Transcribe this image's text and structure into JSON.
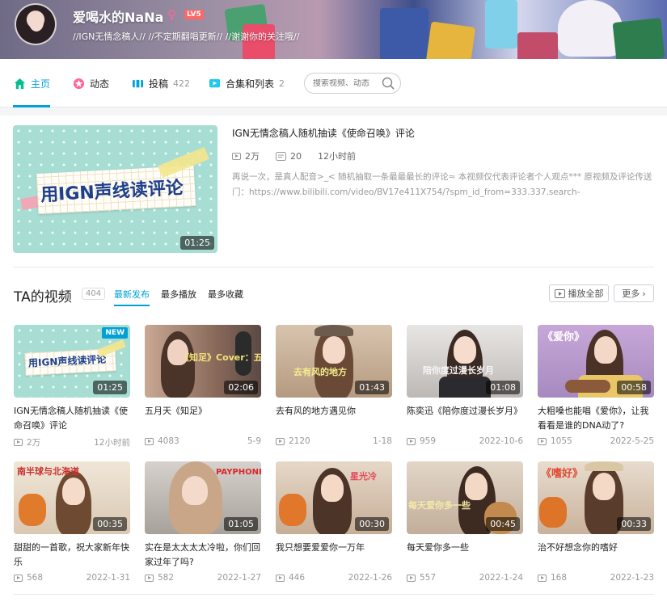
{
  "user": {
    "name": "爱喝水的NaNa",
    "gender_symbol": "♀",
    "level": "LV5",
    "sign": "//IGN无情念稿人// //不定期翻唱更新// //谢谢你的关注哦//"
  },
  "nav": {
    "items": [
      {
        "label": "主页",
        "count": ""
      },
      {
        "label": "动态",
        "count": ""
      },
      {
        "label": "投稿",
        "count": "422"
      },
      {
        "label": "合集和列表",
        "count": "2"
      }
    ],
    "search_placeholder": "搜索视频、动态"
  },
  "featured": {
    "title": "IGN无情念稿人随机抽读《使命召唤》评论",
    "plays": "2万",
    "danmaku": "20",
    "time": "12小时前",
    "description": "再说一次，是真人配音>_< 随机抽取一条最最最长的评论≈ 本视频仅代表评论者个人观点*** 原视频及评论传送门：https://www.bilibili.com/video/BV17e411X754/?spm_id_from=333.337.search-",
    "duration": "01:25",
    "thumb_text": "用IGN声线读评论"
  },
  "videos_section": {
    "title": "TA的视频",
    "count": "404",
    "tabs": [
      "最新发布",
      "最多播放",
      "最多收藏"
    ],
    "play_all": "播放全部",
    "more": "更多"
  },
  "videos": [
    {
      "title": "IGN无情念稿人随机抽读《使命召唤》评论",
      "plays": "2万",
      "date": "12小时前",
      "duration": "01:25",
      "tag": "NEW",
      "caption": "用IGN声线读评论"
    },
    {
      "title": "五月天《知足》",
      "plays": "4083",
      "date": "5-9",
      "duration": "02:06",
      "caption": "《知足》Cover：五月天"
    },
    {
      "title": "去有风的地方遇见你",
      "plays": "2120",
      "date": "1-18",
      "duration": "01:43",
      "caption": "去有风的地方"
    },
    {
      "title": "陈奕迅《陪你度过漫长岁月》",
      "plays": "959",
      "date": "2022-10-6",
      "duration": "01:08",
      "caption": "陪你度过漫长岁月"
    },
    {
      "title": "大粗嗓也能唱《爱你》，让我看看是谁的DNA动了?",
      "plays": "1055",
      "date": "2022-5-25",
      "duration": "00:58",
      "caption": "《爱你》"
    },
    {
      "title": "甜甜的一首歌，祝大家新年快乐",
      "plays": "568",
      "date": "2022-1-31",
      "duration": "00:35",
      "caption": "南半球与北海道"
    },
    {
      "title": "实在是太太太太冷啦，你们回家过年了吗?",
      "plays": "582",
      "date": "2022-1-27",
      "duration": "01:05",
      "caption": "PAYPHONE"
    },
    {
      "title": "我只想要爱爱你一万年",
      "plays": "446",
      "date": "2022-1-26",
      "duration": "00:30",
      "caption": "星光冷"
    },
    {
      "title": "每天爱你多一些",
      "plays": "557",
      "date": "2022-1-24",
      "duration": "00:45",
      "caption": "每天爱你多一些"
    },
    {
      "title": "治不好想念你的嗜好",
      "plays": "168",
      "date": "2022-1-23",
      "duration": "00:33",
      "caption": "《嗜好》"
    }
  ],
  "colors": {
    "accent": "#00a1d6",
    "gender": "#ff6699"
  }
}
